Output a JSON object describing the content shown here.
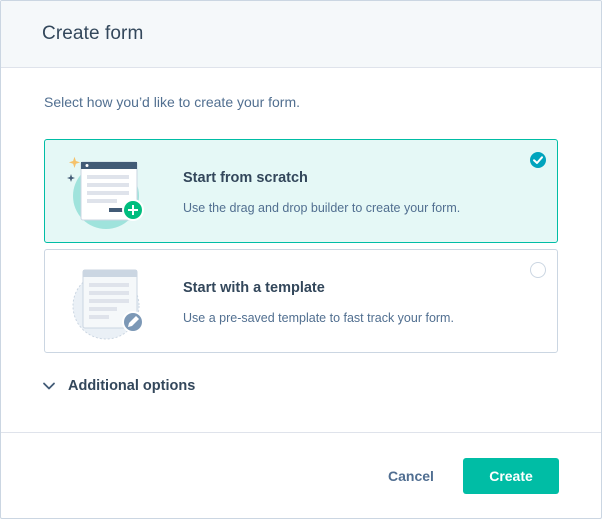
{
  "dialog": {
    "title": "Create form",
    "subtitle": "Select how you’d like to create your form."
  },
  "options": [
    {
      "title": "Start from scratch",
      "description": "Use the drag and drop builder to create your form.",
      "selected": true,
      "illustration_icon": "form-plus-illustration",
      "radio_icon": "check-circle-icon"
    },
    {
      "title": "Start with a template",
      "description": "Use a pre-saved template to fast track your form.",
      "selected": false,
      "illustration_icon": "template-pencil-illustration",
      "radio_icon": "empty-radio-icon"
    }
  ],
  "additional_options": {
    "label": "Additional options",
    "icon": "chevron-down-icon"
  },
  "footer": {
    "cancel_label": "Cancel",
    "create_label": "Create"
  },
  "colors": {
    "accent": "#00bda5",
    "selected_bg": "#e5f8f6",
    "check": "#00a4bd",
    "text": "#33475b"
  }
}
